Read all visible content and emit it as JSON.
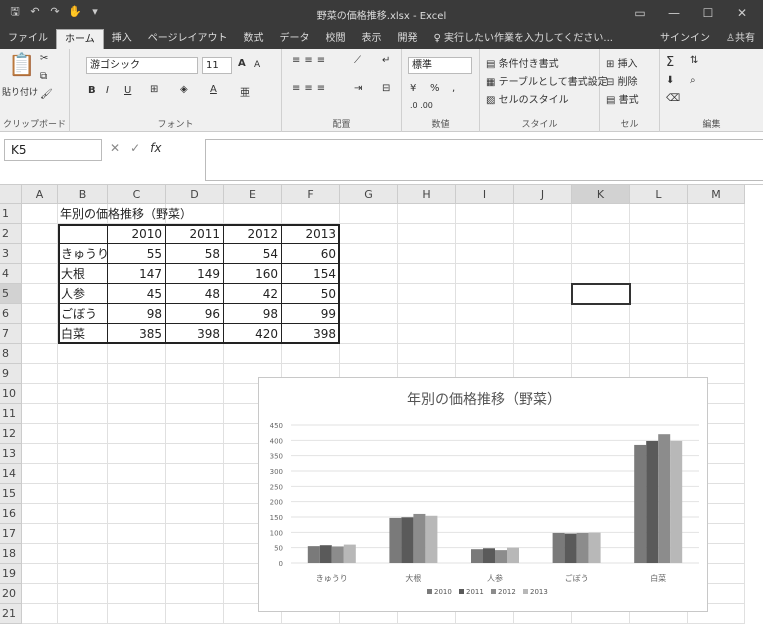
{
  "window": {
    "title": "野菜の価格推移.xlsx - Excel",
    "qa_icons": [
      "save-icon",
      "undo-icon",
      "redo-icon",
      "touch-icon",
      "customize-icon"
    ]
  },
  "tabs": [
    "ファイル",
    "ホーム",
    "挿入",
    "ページレイアウト",
    "数式",
    "データ",
    "校閲",
    "表示",
    "開発"
  ],
  "tell_me": "実行したい作業を入力してください...",
  "signin": "サインイン",
  "share": "共有",
  "ribbon": {
    "clipboard": {
      "label": "クリップボード",
      "paste": "貼り付け"
    },
    "font": {
      "label": "フォント",
      "name": "游ゴシック",
      "size": "11",
      "bold": "B",
      "italic": "I",
      "underline": "U",
      "grow": "A",
      "shrink": "A"
    },
    "alignment": {
      "label": "配置"
    },
    "number": {
      "label": "数値",
      "format": "標準",
      "percent": "%"
    },
    "styles": {
      "label": "スタイル",
      "cond": "条件付き書式",
      "table": "テーブルとして書式設定",
      "cell": "セルのスタイル"
    },
    "cells": {
      "label": "セル",
      "insert": "挿入",
      "delete": "削除",
      "format": "書式"
    },
    "editing": {
      "label": "編集",
      "sum": "Σ"
    }
  },
  "namebox": "K5",
  "columns": [
    "A",
    "B",
    "C",
    "D",
    "E",
    "F",
    "G",
    "H",
    "I",
    "J",
    "K",
    "L",
    "M"
  ],
  "rows": [
    "1",
    "2",
    "3",
    "4",
    "5",
    "6",
    "7",
    "8",
    "9",
    "10",
    "11",
    "12",
    "13",
    "14",
    "15",
    "16",
    "17",
    "18",
    "19",
    "20",
    "21"
  ],
  "selected_cell": "K5",
  "sheet_title": "年別の価格推移（野菜）",
  "table": {
    "years": [
      "2010",
      "2011",
      "2012",
      "2013"
    ],
    "rows": [
      {
        "name": "きゅうり",
        "v": [
          "55",
          "58",
          "54",
          "60"
        ]
      },
      {
        "name": "大根",
        "v": [
          "147",
          "149",
          "160",
          "154"
        ]
      },
      {
        "name": "人参",
        "v": [
          "45",
          "48",
          "42",
          "50"
        ]
      },
      {
        "name": "ごぼう",
        "v": [
          "98",
          "96",
          "98",
          "99"
        ]
      },
      {
        "name": "白菜",
        "v": [
          "385",
          "398",
          "420",
          "398"
        ]
      }
    ]
  },
  "chart_data": {
    "type": "bar",
    "title": "年別の価格推移（野菜）",
    "categories": [
      "きゅうり",
      "大根",
      "人参",
      "ごぼう",
      "白菜"
    ],
    "series": [
      {
        "name": "2010",
        "values": [
          55,
          147,
          45,
          98,
          385
        ]
      },
      {
        "name": "2011",
        "values": [
          58,
          149,
          48,
          96,
          398
        ]
      },
      {
        "name": "2012",
        "values": [
          54,
          160,
          42,
          98,
          420
        ]
      },
      {
        "name": "2013",
        "values": [
          60,
          154,
          50,
          99,
          398
        ]
      }
    ],
    "ylim": [
      0,
      450
    ],
    "yticks": [
      0,
      50,
      100,
      150,
      200,
      250,
      300,
      350,
      400,
      450
    ],
    "grid": true,
    "legend": "bottom",
    "colors": [
      "#7a7a7a",
      "#5a5a5a",
      "#8c8c8c",
      "#b8b8b8"
    ]
  }
}
